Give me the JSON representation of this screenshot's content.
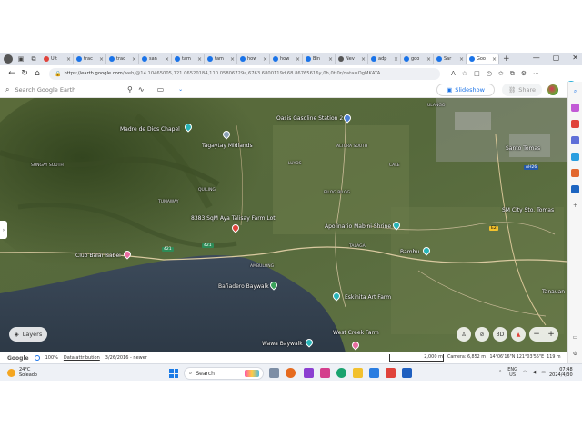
{
  "browser": {
    "tabs": [
      {
        "label": "Ult",
        "color": "#e0433b"
      },
      {
        "label": "trac",
        "color": "#1a73e8"
      },
      {
        "label": "trac",
        "color": "#1a73e8"
      },
      {
        "label": "san",
        "color": "#1a73e8"
      },
      {
        "label": "tam",
        "color": "#1a73e8"
      },
      {
        "label": "tam",
        "color": "#1a73e8"
      },
      {
        "label": "how",
        "color": "#1a73e8"
      },
      {
        "label": "how",
        "color": "#1a73e8"
      },
      {
        "label": "Bin",
        "color": "#1a73e8"
      },
      {
        "label": "Nev",
        "color": "#555555"
      },
      {
        "label": "adp",
        "color": "#1a73e8"
      },
      {
        "label": "goo",
        "color": "#1a73e8"
      },
      {
        "label": "Sar",
        "color": "#1a73e8"
      },
      {
        "label": "Goo",
        "color": "#1a73e8",
        "active": true
      }
    ],
    "new_tab_label": "+",
    "close_label": "×",
    "window_controls": [
      "—",
      "▢",
      "✕"
    ],
    "url_host": "https://earth.google.com",
    "url_rest": "/web/@14.10465005,121.06520184,110.05806729a,6763.6800119d,68.86765616y,0h,0t,0r/data=OgMKATA",
    "profile_initial": "A"
  },
  "earth": {
    "search_placeholder": "Search Google Earth",
    "slideshow_label": "Slideshow",
    "share_label": "Share",
    "layers_label": "Layers",
    "ctl_3d": "3D",
    "zoom_minus": "−",
    "zoom_plus": "+"
  },
  "places": [
    {
      "name": "Tagaytay Picnic Grove",
      "type": "label"
    },
    {
      "name": "Madre de Dios Chapel",
      "type": "label"
    },
    {
      "name": "Tagaytay Midlands",
      "type": "label"
    },
    {
      "name": "Oasis Gasoline Station 2",
      "type": "label"
    },
    {
      "name": "Santo Tomas",
      "type": "label"
    },
    {
      "name": "SM City Sto. Tomas",
      "type": "label"
    },
    {
      "name": "8383 SqM Aya Talisay Farm Lot",
      "type": "label"
    },
    {
      "name": "Apolinario Mabini Shrine",
      "type": "label"
    },
    {
      "name": "Bambu",
      "type": "label"
    },
    {
      "name": "Club Balai Isabel",
      "type": "label"
    },
    {
      "name": "Bañadero Baywalk",
      "type": "label"
    },
    {
      "name": "Eskinita Art Farm",
      "type": "label"
    },
    {
      "name": "Tanauan",
      "type": "label"
    },
    {
      "name": "Wawa Baywalk",
      "type": "label"
    },
    {
      "name": "West Creek Farm",
      "type": "label"
    }
  ],
  "small_places": [
    "SUNGAY SOUTH",
    "ALTURA SOUTH",
    "LUYOS",
    "CALE",
    "QUILING",
    "TUMAWAY",
    "BILOG BILOG",
    "TALAGA",
    "AMBULONG",
    "ULANGO"
  ],
  "shields": {
    "r1": "421",
    "r2": "421",
    "r3": "AH26",
    "r4": "E2"
  },
  "status": {
    "google": "Google",
    "zoom": "100%",
    "attribution": "Data attribution",
    "date": "3/26/2016 - newer",
    "scale": "2,000 m",
    "camera": "Camera: 6,852 m",
    "coords": "14°06'16\"N 121°03'55\"E",
    "elev": "119 m"
  },
  "taskbar": {
    "temp": "24°C",
    "weather": "Soleado",
    "search": "Search",
    "lang": "ENG",
    "region": "US",
    "time": "07:48",
    "date": "2024/4/30"
  }
}
